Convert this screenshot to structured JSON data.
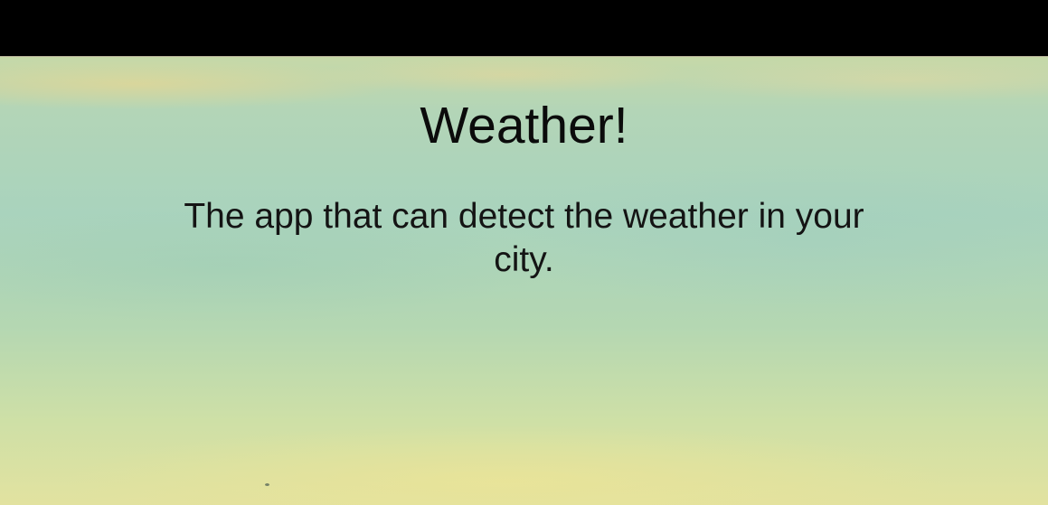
{
  "header": {
    "title": "Weather!",
    "subtitle": "The app that can detect the weather in your city."
  },
  "colors": {
    "top_bar": "#000000",
    "text": "#0b0b0b"
  }
}
